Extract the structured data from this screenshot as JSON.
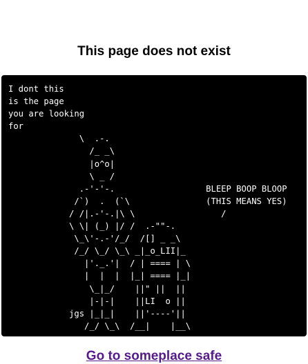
{
  "page": {
    "title": "This page does not exist",
    "ascii_art": "I dont this\nis the page\nyou are looking\nfor\n              \\  .-.\n                /_ _\\\n                |o^o|\n                \\ _ /\n              .-'-'-.                  BLEEP BOOP BLOOP\n             /`)  .  (`\\               (THIS MEANS YES)\n            / /|.-'-.|\\ \\                 /\n            \\ \\| (_) |/ /  .-\"\"-.        \n             \\_\\'-.-'/_/  /[] _ _\\      \n             /_/ \\_/ \\_\\ _|_o_LII|_\n               |'._.'|  / | ==== | \\\n               |  |  |  |_| ==== |_|\n                \\_|_/    ||\" ||  ||\n                |-|-|    ||LI  o ||\n            jgs |_|_|    ||'----'||\n               /_/ \\_\\  /__|    |__\\",
    "link_text": "Go to someplace safe"
  }
}
